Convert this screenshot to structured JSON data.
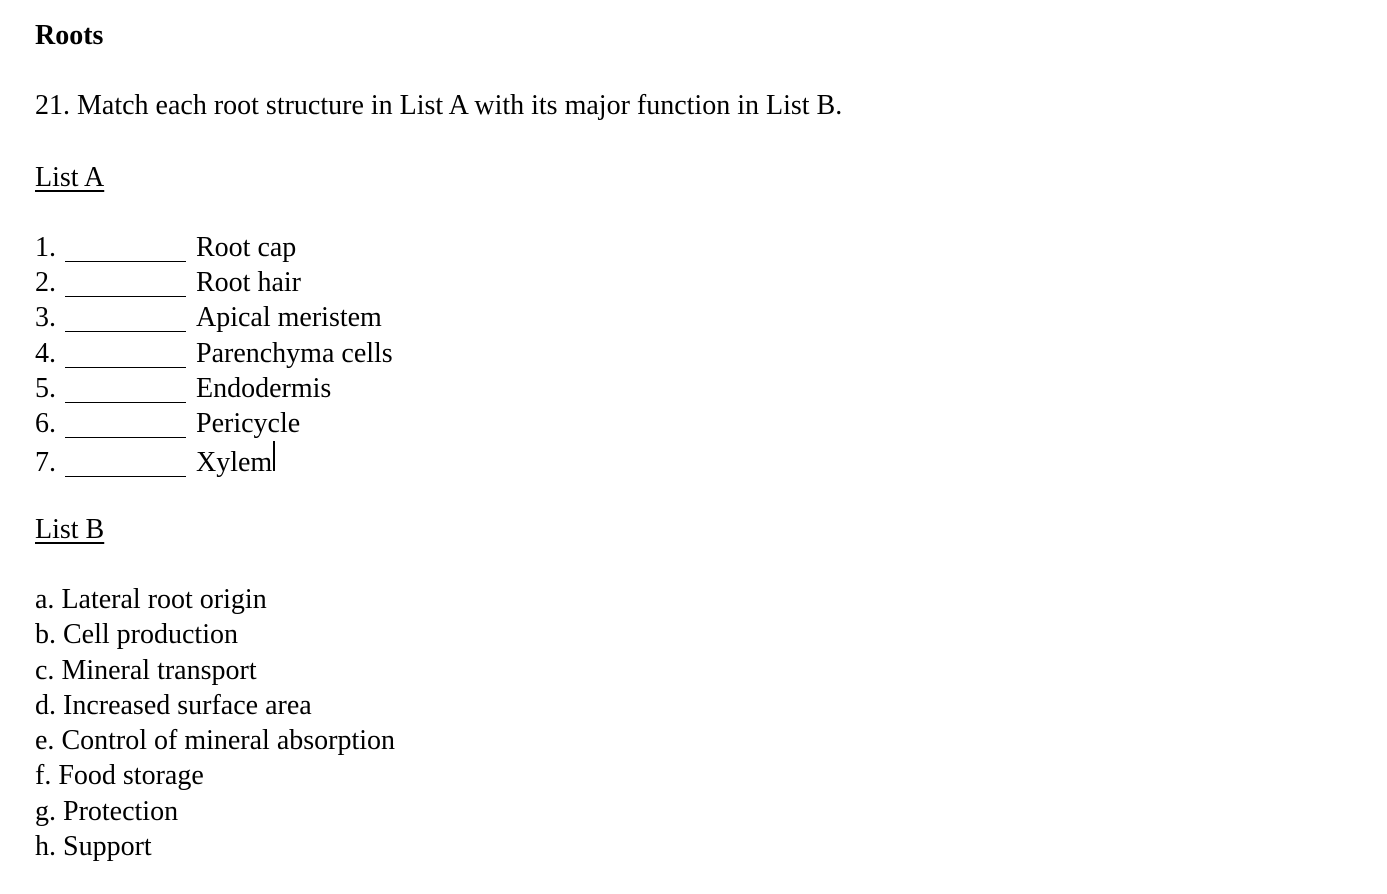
{
  "document": {
    "title": "Roots",
    "question": "21. Match each root structure in List A with its major function in List B.",
    "list_a": {
      "heading": "List A",
      "items": [
        {
          "number": "1.",
          "answer": "",
          "term": "Root cap"
        },
        {
          "number": "2.",
          "answer": "",
          "term": "Root hair"
        },
        {
          "number": "3.",
          "answer": "",
          "term": "Apical meristem"
        },
        {
          "number": "4.",
          "answer": "",
          "term": "Parenchyma cells"
        },
        {
          "number": "5.",
          "answer": "",
          "term": "Endodermis"
        },
        {
          "number": "6.",
          "answer": "",
          "term": "Pericycle"
        },
        {
          "number": "7.",
          "answer": "",
          "term": "Xylem"
        }
      ]
    },
    "list_b": {
      "heading": "List B",
      "items": [
        {
          "letter": "a.",
          "function": "Lateral root origin"
        },
        {
          "letter": "b.",
          "function": "Cell production"
        },
        {
          "letter": "c.",
          "function": "Mineral transport"
        },
        {
          "letter": "d.",
          "function": "Increased surface area"
        },
        {
          "letter": "e.",
          "function": "Control of mineral absorption"
        },
        {
          "letter": "f.",
          "function": "Food storage"
        },
        {
          "letter": "g.",
          "function": "Protection"
        },
        {
          "letter": "h.",
          "function": "Support"
        }
      ]
    }
  }
}
